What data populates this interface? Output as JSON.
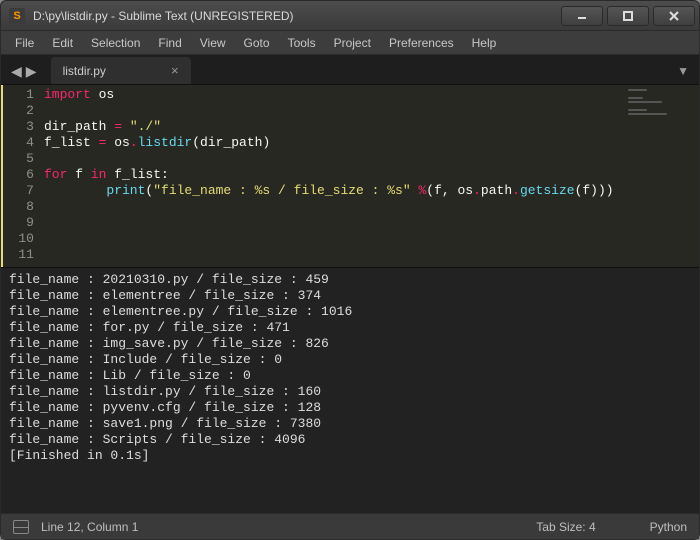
{
  "window": {
    "title": "D:\\py\\listdir.py - Sublime Text (UNREGISTERED)",
    "app_icon_letter": "S"
  },
  "menu": {
    "items": [
      "File",
      "Edit",
      "Selection",
      "Find",
      "View",
      "Goto",
      "Tools",
      "Project",
      "Preferences",
      "Help"
    ]
  },
  "tabs": {
    "nav_back": "◀",
    "nav_fwd": "▶",
    "dropdown": "▼",
    "open": [
      {
        "label": "listdir.py",
        "close": "×"
      }
    ]
  },
  "editor": {
    "line_count": 11,
    "code_lines": [
      [
        [
          "kw",
          "import"
        ],
        [
          "sp",
          " "
        ],
        [
          "id",
          "os"
        ]
      ],
      [],
      [
        [
          "id",
          "dir_path "
        ],
        [
          "op",
          "="
        ],
        [
          "sp",
          " "
        ],
        [
          "str",
          "\"./\""
        ]
      ],
      [
        [
          "id",
          "f_list "
        ],
        [
          "op",
          "="
        ],
        [
          "sp",
          " "
        ],
        [
          "id",
          "os"
        ],
        [
          "op",
          "."
        ],
        [
          "fn",
          "listdir"
        ],
        [
          "id",
          "(dir_path)"
        ]
      ],
      [],
      [
        [
          "kw",
          "for"
        ],
        [
          "sp",
          " "
        ],
        [
          "id",
          "f "
        ],
        [
          "kw",
          "in"
        ],
        [
          "sp",
          " "
        ],
        [
          "id",
          "f_list:"
        ]
      ],
      [
        [
          "sp",
          "        "
        ],
        [
          "fn",
          "print"
        ],
        [
          "id",
          "("
        ],
        [
          "str",
          "\"file_name : %s / file_size : %s\""
        ],
        [
          "sp",
          " "
        ],
        [
          "op",
          "%"
        ],
        [
          "id",
          "(f, os"
        ],
        [
          "op",
          "."
        ],
        [
          "id",
          "path"
        ],
        [
          "op",
          "."
        ],
        [
          "fn",
          "getsize"
        ],
        [
          "id",
          "(f)))"
        ]
      ],
      [],
      [],
      [],
      []
    ]
  },
  "output": {
    "prefix_name": "file_name : ",
    "sep": " / ",
    "prefix_size": "file_size : ",
    "rows": [
      {
        "name": "20210310.py",
        "size": 459
      },
      {
        "name": "elementree",
        "size": 374
      },
      {
        "name": "elementree.py",
        "size": 1016
      },
      {
        "name": "for.py",
        "size": 471
      },
      {
        "name": "img_save.py",
        "size": 826
      },
      {
        "name": "Include",
        "size": 0
      },
      {
        "name": "Lib",
        "size": 0
      },
      {
        "name": "listdir.py",
        "size": 160
      },
      {
        "name": "pyvenv.cfg",
        "size": 128
      },
      {
        "name": "save1.png",
        "size": 7380
      },
      {
        "name": "Scripts",
        "size": 4096
      }
    ],
    "finished": "[Finished in 0.1s]"
  },
  "status": {
    "cursor": "Line 12, Column 1",
    "tabsize": "Tab Size: 4",
    "syntax": "Python"
  }
}
